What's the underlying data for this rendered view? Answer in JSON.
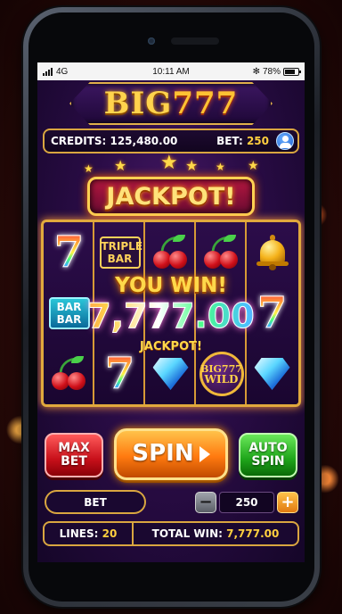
{
  "status_bar": {
    "network": "4G",
    "time": "10:11 AM",
    "bluetooth": "✻",
    "battery": "78%",
    "battery_level": 0.78
  },
  "logo": {
    "part1": "BIG",
    "part2": "777"
  },
  "header": {
    "credits_label": "CREDITS:",
    "credits_value": "125,480.00",
    "bet_label": "BET:",
    "bet_value": "250",
    "profile_icon": "user-icon"
  },
  "banner": {
    "text": "JACKPOT!"
  },
  "reels": [
    [
      "seven",
      "double-bar",
      "cherries"
    ],
    [
      "triple-bar",
      "",
      "seven"
    ],
    [
      "cherries",
      "",
      "diamond"
    ],
    [
      "cherries",
      "",
      "wild"
    ],
    [
      "bell",
      "seven",
      "diamond"
    ]
  ],
  "symbol_text": {
    "triple_bar": [
      "TRIPLE",
      "BAR"
    ],
    "double_bar": [
      "BAR",
      "BAR"
    ],
    "seven": "7",
    "wild": [
      "BIG777",
      "WILD"
    ]
  },
  "win": {
    "headline": "YOU WIN!",
    "amount": "7,777.00",
    "label": "JACKPOT!"
  },
  "buttons": {
    "max_bet": [
      "MAX",
      "BET"
    ],
    "spin": "SPIN",
    "auto_spin": [
      "AUTO",
      "SPIN"
    ]
  },
  "bet_control": {
    "label": "BET",
    "value": "250",
    "minus": "−",
    "plus": "+"
  },
  "footer": {
    "lines_label": "LINES:",
    "lines_value": "20",
    "total_win_label": "TOTAL WIN:",
    "total_win_value": "7,777.00"
  },
  "colors": {
    "gold": "#ffcf3f",
    "frame": "#d9a640",
    "spin": "#ff7a10",
    "max_bet": "#c8101a",
    "auto_spin": "#1ea51a"
  }
}
